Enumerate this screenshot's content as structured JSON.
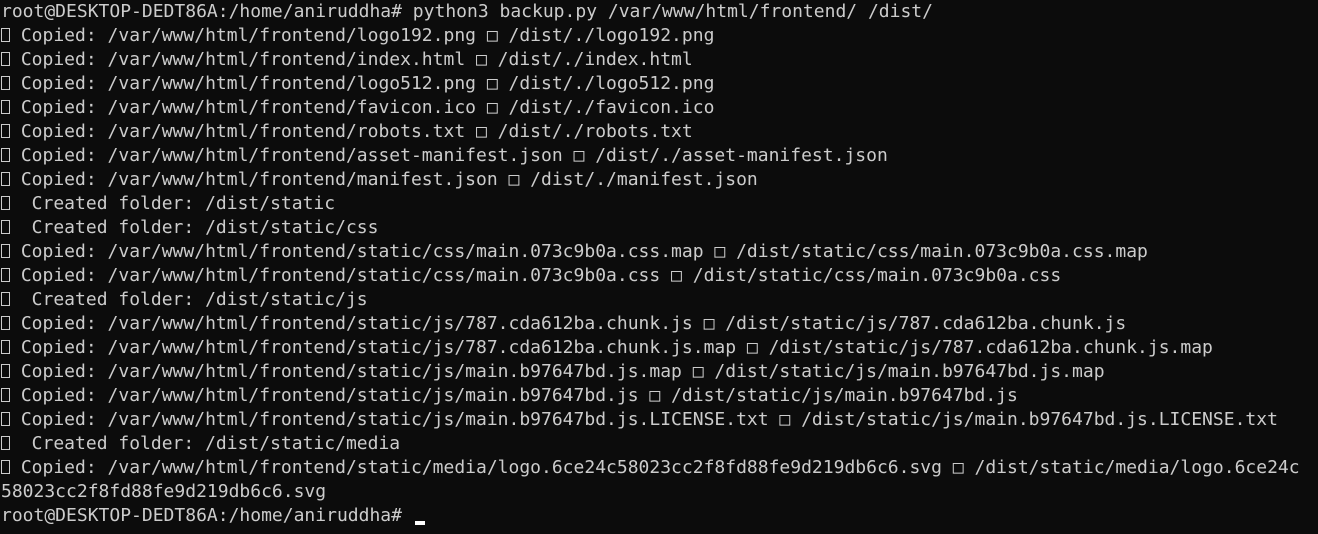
{
  "terminal": {
    "prompt_command": "root@DESKTOP-DEDT86A:/home/aniruddha# python3 backup.py /var/www/html/frontend/ /dist/",
    "lines": [
      {
        "icon": "unknown-glyph-icon",
        "text": " Copied: /var/www/html/frontend/logo192.png □ /dist/./logo192.png"
      },
      {
        "icon": "unknown-glyph-icon",
        "text": " Copied: /var/www/html/frontend/index.html □ /dist/./index.html"
      },
      {
        "icon": "unknown-glyph-icon",
        "text": " Copied: /var/www/html/frontend/logo512.png □ /dist/./logo512.png"
      },
      {
        "icon": "unknown-glyph-icon",
        "text": " Copied: /var/www/html/frontend/favicon.ico □ /dist/./favicon.ico"
      },
      {
        "icon": "unknown-glyph-icon",
        "text": " Copied: /var/www/html/frontend/robots.txt □ /dist/./robots.txt"
      },
      {
        "icon": "unknown-glyph-icon",
        "text": " Copied: /var/www/html/frontend/asset-manifest.json □ /dist/./asset-manifest.json"
      },
      {
        "icon": "unknown-glyph-icon",
        "text": " Copied: /var/www/html/frontend/manifest.json □ /dist/./manifest.json"
      },
      {
        "icon": "unknown-glyph-icon",
        "text": "  Created folder: /dist/static"
      },
      {
        "icon": "unknown-glyph-icon",
        "text": "  Created folder: /dist/static/css"
      },
      {
        "icon": "unknown-glyph-icon",
        "text": " Copied: /var/www/html/frontend/static/css/main.073c9b0a.css.map □ /dist/static/css/main.073c9b0a.css.map"
      },
      {
        "icon": "unknown-glyph-icon",
        "text": " Copied: /var/www/html/frontend/static/css/main.073c9b0a.css □ /dist/static/css/main.073c9b0a.css"
      },
      {
        "icon": "unknown-glyph-icon",
        "text": "  Created folder: /dist/static/js"
      },
      {
        "icon": "unknown-glyph-icon",
        "text": " Copied: /var/www/html/frontend/static/js/787.cda612ba.chunk.js □ /dist/static/js/787.cda612ba.chunk.js"
      },
      {
        "icon": "unknown-glyph-icon",
        "text": " Copied: /var/www/html/frontend/static/js/787.cda612ba.chunk.js.map □ /dist/static/js/787.cda612ba.chunk.js.map"
      },
      {
        "icon": "unknown-glyph-icon",
        "text": " Copied: /var/www/html/frontend/static/js/main.b97647bd.js.map □ /dist/static/js/main.b97647bd.js.map"
      },
      {
        "icon": "unknown-glyph-icon",
        "text": " Copied: /var/www/html/frontend/static/js/main.b97647bd.js □ /dist/static/js/main.b97647bd.js"
      },
      {
        "icon": "unknown-glyph-icon",
        "text": " Copied: /var/www/html/frontend/static/js/main.b97647bd.js.LICENSE.txt □ /dist/static/js/main.b97647bd.js.LICENSE.txt"
      },
      {
        "icon": "unknown-glyph-icon",
        "text": "  Created folder: /dist/static/media"
      },
      {
        "icon": "unknown-glyph-icon",
        "text": " Copied: /var/www/html/frontend/static/media/logo.6ce24c58023cc2f8fd88fe9d219db6c6.svg □ /dist/static/media/logo.6ce24c"
      },
      {
        "icon": "",
        "text": "58023cc2f8fd88fe9d219db6c6.svg"
      }
    ],
    "final_prompt": "root@DESKTOP-DEDT86A:/home/aniruddha# ",
    "colors": {
      "background": "#0c0c0c",
      "foreground": "#cccccc",
      "cursor": "#ffffff"
    }
  }
}
